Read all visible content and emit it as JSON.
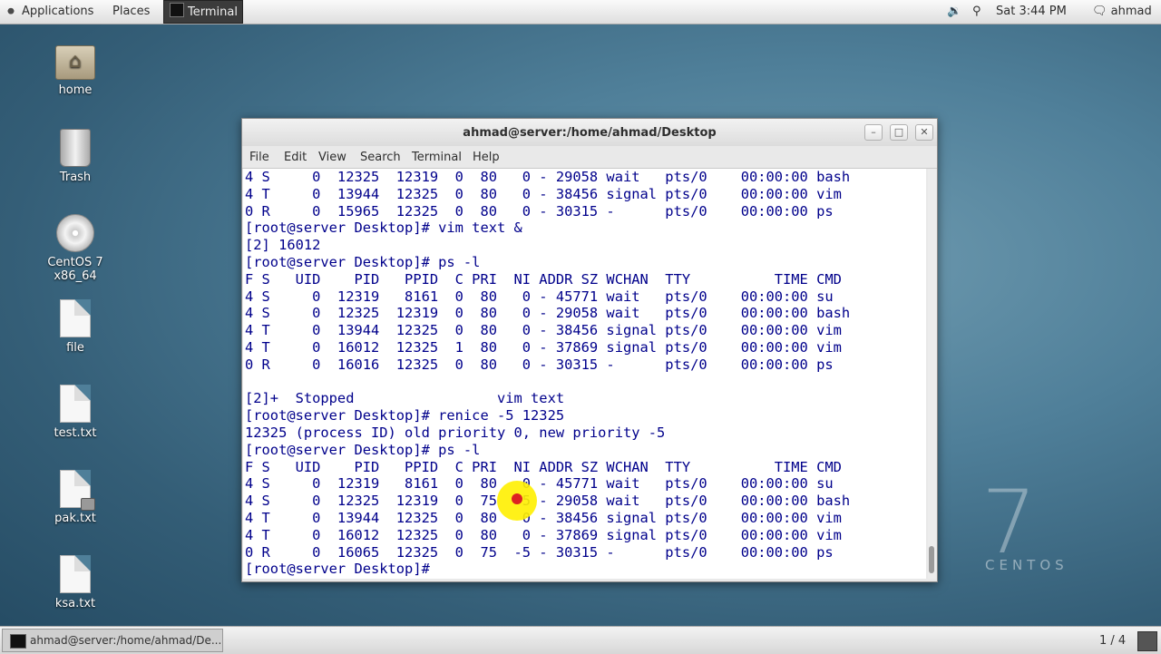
{
  "top_panel": {
    "applications": "Applications",
    "places": "Places",
    "terminal_task": "Terminal",
    "volume_icon": "speaker-icon",
    "network_icon": "network-icon",
    "clock": "Sat  3:44 PM",
    "user": "ahmad"
  },
  "desktop_icons": [
    {
      "label": "home",
      "icon": "home-folder-icon"
    },
    {
      "label": "Trash",
      "icon": "trash-icon"
    },
    {
      "label": "CentOS 7 x86_64",
      "icon": "dvd-icon"
    },
    {
      "label": "file",
      "icon": "file-icon"
    },
    {
      "label": "test.txt",
      "icon": "file-icon"
    },
    {
      "label": "pak.txt",
      "icon": "locked-file-icon"
    },
    {
      "label": "ksa.txt",
      "icon": "file-icon"
    }
  ],
  "watermark": {
    "number": "7",
    "word": "CENTOS"
  },
  "terminal": {
    "title": "ahmad@server:/home/ahmad/Desktop",
    "menu": [
      "File",
      "Edit",
      "View",
      "Search",
      "Terminal",
      "Help"
    ],
    "buttons": {
      "minimize": "–",
      "maximize": "□",
      "close": "✕"
    },
    "lines": [
      "4 S     0  12325  12319  0  80   0 - 29058 wait   pts/0    00:00:00 bash",
      "4 T     0  13944  12325  0  80   0 - 38456 signal pts/0    00:00:00 vim",
      "0 R     0  15965  12325  0  80   0 - 30315 -      pts/0    00:00:00 ps",
      "[root@server Desktop]# vim text &",
      "[2] 16012",
      "[root@server Desktop]# ps -l",
      "F S   UID    PID   PPID  C PRI  NI ADDR SZ WCHAN  TTY          TIME CMD",
      "4 S     0  12319   8161  0  80   0 - 45771 wait   pts/0    00:00:00 su",
      "4 S     0  12325  12319  0  80   0 - 29058 wait   pts/0    00:00:00 bash",
      "4 T     0  13944  12325  0  80   0 - 38456 signal pts/0    00:00:00 vim",
      "4 T     0  16012  12325  1  80   0 - 37869 signal pts/0    00:00:00 vim",
      "0 R     0  16016  12325  0  80   0 - 30315 -      pts/0    00:00:00 ps",
      "",
      "[2]+  Stopped                 vim text",
      "[root@server Desktop]# renice -5 12325",
      "12325 (process ID) old priority 0, new priority -5",
      "[root@server Desktop]# ps -l",
      "F S   UID    PID   PPID  C PRI  NI ADDR SZ WCHAN  TTY          TIME CMD",
      "4 S     0  12319   8161  0  80   0 - 45771 wait   pts/0    00:00:00 su",
      "4 S     0  12325  12319  0  75  -5 - 29058 wait   pts/0    00:00:00 bash",
      "4 T     0  13944  12325  0  80   0 - 38456 signal pts/0    00:00:00 vim",
      "4 T     0  16012  12325  0  80   0 - 37869 signal pts/0    00:00:00 vim",
      "0 R     0  16065  12325  0  75  -5 - 30315 -      pts/0    00:00:00 ps",
      "[root@server Desktop]# "
    ]
  },
  "bottom_panel": {
    "task": "ahmad@server:/home/ahmad/De...",
    "workspace": "1 / 4"
  }
}
